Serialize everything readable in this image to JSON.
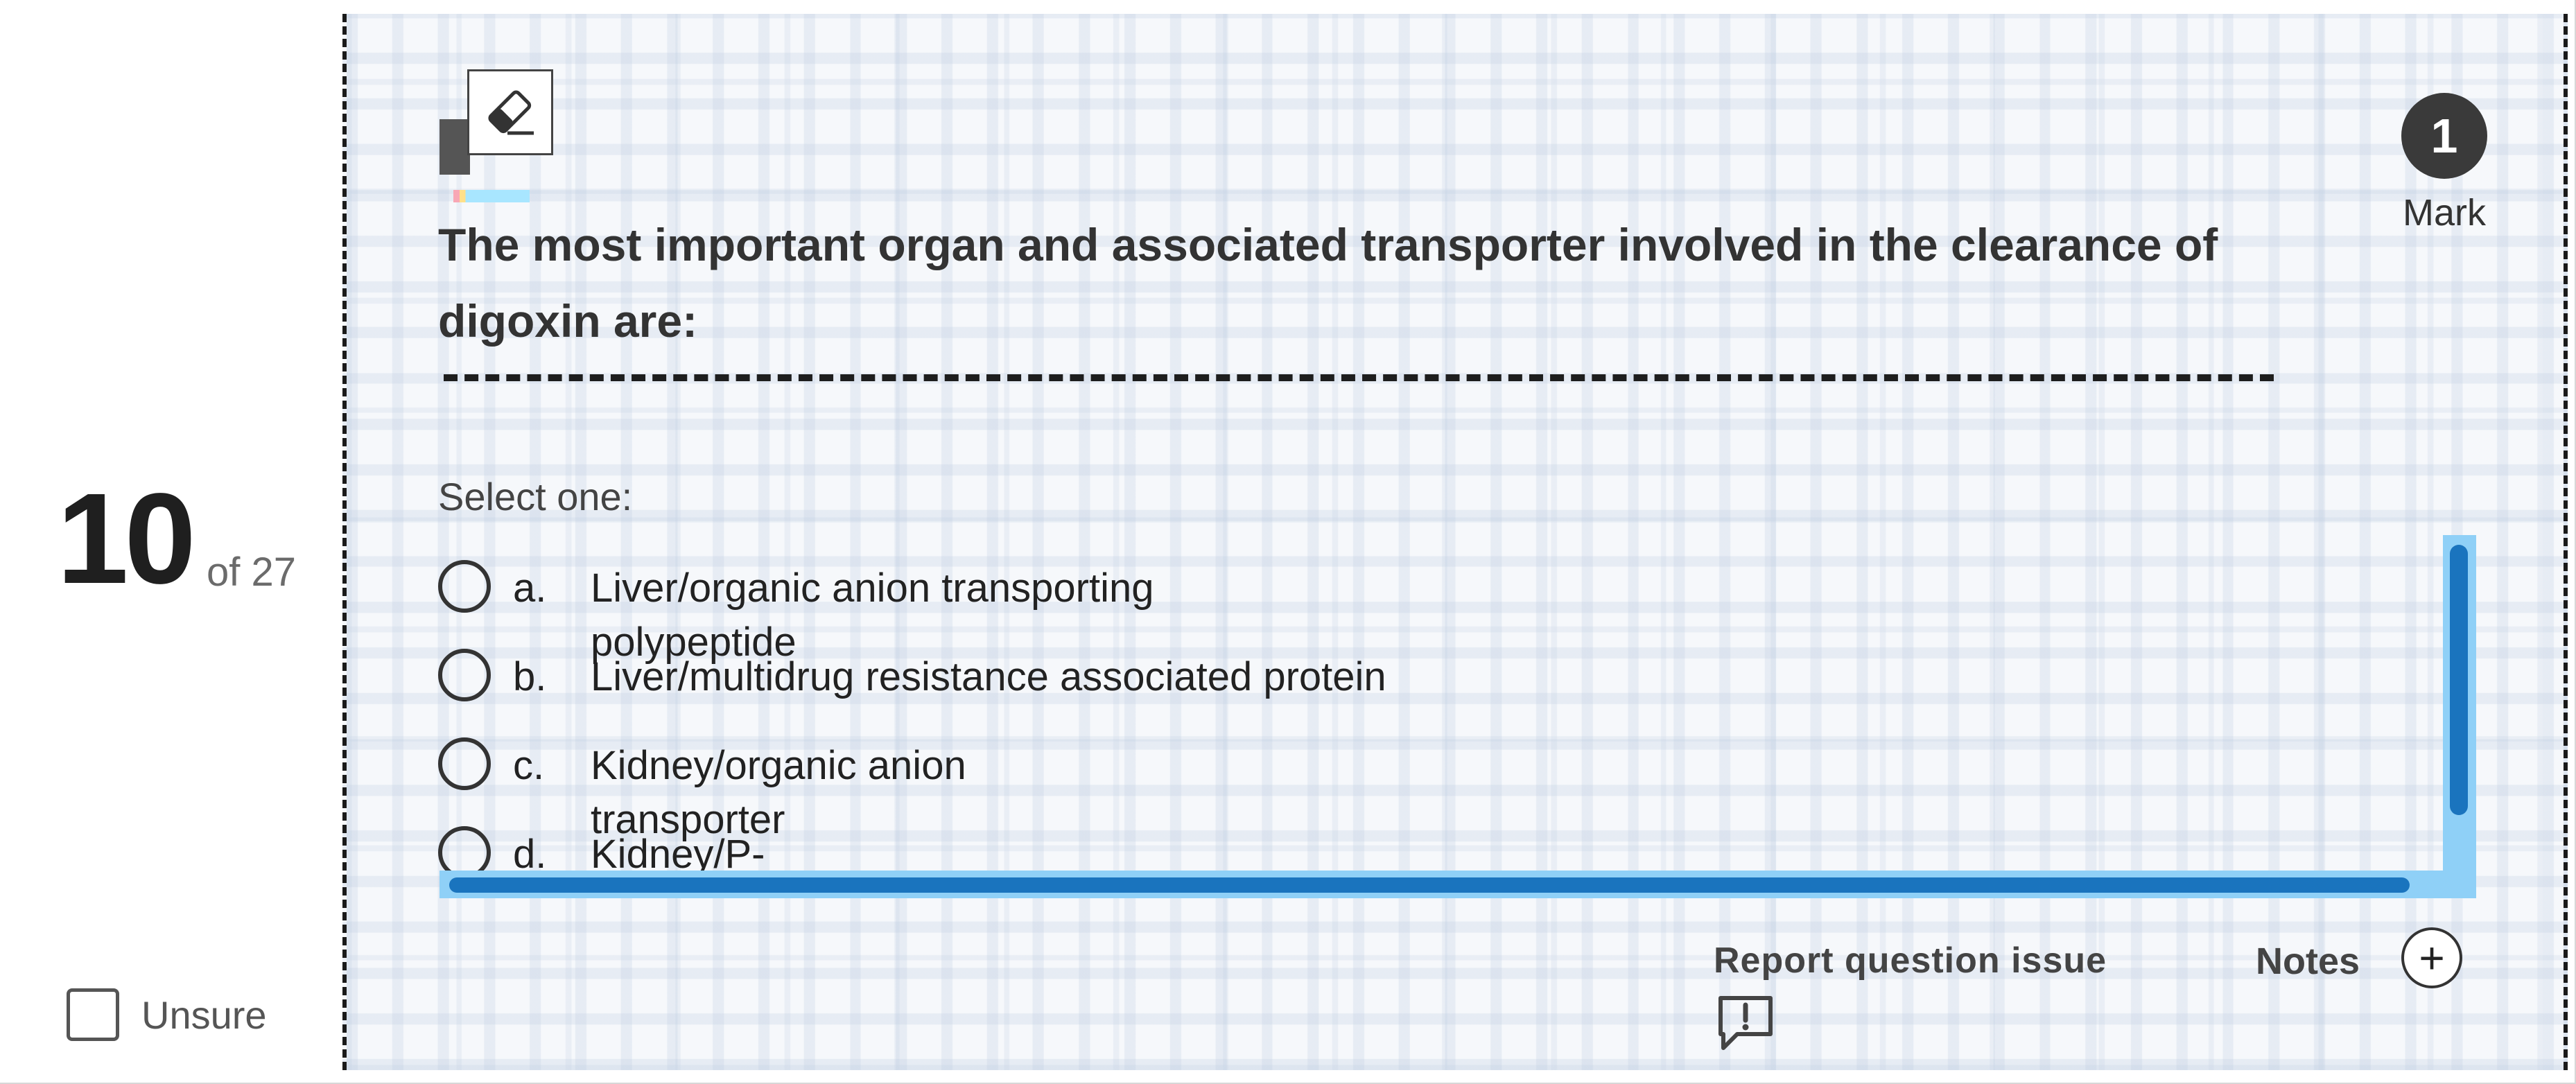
{
  "question": {
    "number": "10",
    "of_total": "of 27",
    "marks": "1",
    "marks_label": "Mark",
    "stem": "The most important organ and associated transporter involved in the clearance of digoxin are:",
    "instruction": "Select one:",
    "options": [
      {
        "letter": "a.",
        "text": "Liver/organic anion transporting polypeptide"
      },
      {
        "letter": "b.",
        "text": "Liver/multidrug resistance associated protein"
      },
      {
        "letter": "c.",
        "text": "Kidney/organic anion transporter"
      },
      {
        "letter": "d.",
        "text": "Kidney/P-"
      }
    ]
  },
  "sidebar": {
    "unsure_label": "Unsure"
  },
  "footer": {
    "report_label": "Report question issue",
    "notes_label": "Notes"
  },
  "icons": {
    "eraser": "eraser-icon",
    "report": "report-issue-icon",
    "notes_add": "plus-icon"
  },
  "colors": {
    "scrollbar_track": "#8fd0f7",
    "scrollbar_thumb": "#1a74be",
    "badge": "#3a3a3a"
  }
}
